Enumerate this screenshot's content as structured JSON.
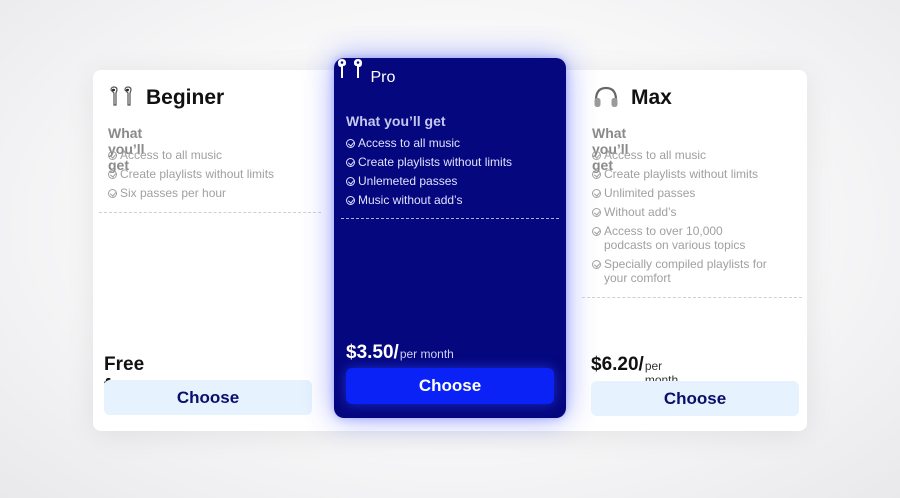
{
  "plans": {
    "beginer": {
      "title": "Beginer",
      "icon": "earbuds-icon",
      "subhead": "What you’ll get",
      "features": [
        "Access to all music",
        "Create playlists without limits",
        "Six passes per hour"
      ],
      "price_text": "Free forever",
      "button": "Choose"
    },
    "pro": {
      "title": "Pro",
      "icon": "earbuds-icon",
      "subhead": "What you’ll get",
      "features": [
        "Access to all music",
        "Create playlists without limits",
        "Unlemeted passes",
        "Music without add’s"
      ],
      "price": "$3.50/",
      "per": "per month",
      "button": "Choose"
    },
    "max": {
      "title": "Max",
      "icon": "headphones-icon",
      "subhead": "What you’ll get",
      "features": [
        "Access to all music",
        "Create playlists without limits",
        "Unlimited passes",
        "Without add’s",
        "Access to over 10,000 podcasts on various topics",
        "Specially compiled playlists for your comfort"
      ],
      "price": "$6.20/",
      "per": "per month",
      "button": "Choose"
    }
  },
  "colors": {
    "pro_bg": "#05077e",
    "pro_button": "#0a22f5",
    "light_button": "#e6f2fd",
    "button_text_dark": "#0a0f6e"
  }
}
